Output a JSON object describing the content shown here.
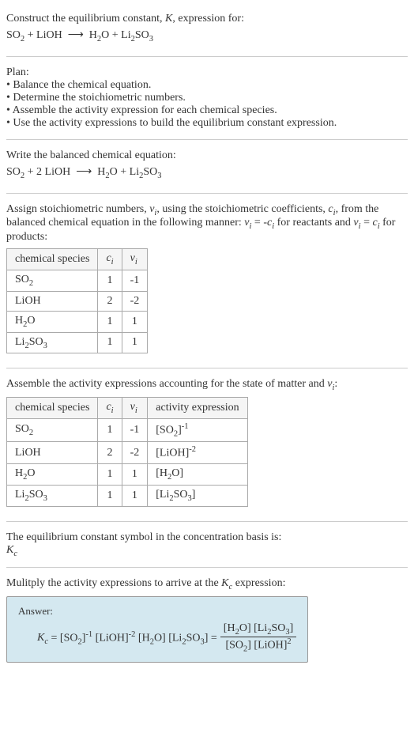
{
  "intro": {
    "line1": "Construct the equilibrium constant, K, expression for:",
    "equation": "SO₂ + LiOH ⟶ H₂O + Li₂SO₃"
  },
  "plan": {
    "heading": "Plan:",
    "items": [
      "Balance the chemical equation.",
      "Determine the stoichiometric numbers.",
      "Assemble the activity expression for each chemical species.",
      "Use the activity expressions to build the equilibrium constant expression."
    ]
  },
  "balanced": {
    "heading": "Write the balanced chemical equation:",
    "equation": "SO₂ + 2 LiOH ⟶ H₂O + Li₂SO₃"
  },
  "stoich": {
    "text1": "Assign stoichiometric numbers, νᵢ, using the stoichiometric coefficients, cᵢ, from the balanced chemical equation in the following manner: νᵢ = -cᵢ for reactants and νᵢ = cᵢ for products:",
    "headers": [
      "chemical species",
      "cᵢ",
      "νᵢ"
    ],
    "rows": [
      {
        "species": "SO₂",
        "c": "1",
        "v": "-1"
      },
      {
        "species": "LiOH",
        "c": "2",
        "v": "-2"
      },
      {
        "species": "H₂O",
        "c": "1",
        "v": "1"
      },
      {
        "species": "Li₂SO₃",
        "c": "1",
        "v": "1"
      }
    ]
  },
  "activity": {
    "heading": "Assemble the activity expressions accounting for the state of matter and νᵢ:",
    "headers": [
      "chemical species",
      "cᵢ",
      "νᵢ",
      "activity expression"
    ],
    "rows": [
      {
        "species": "SO₂",
        "c": "1",
        "v": "-1",
        "expr": "[SO₂]⁻¹"
      },
      {
        "species": "LiOH",
        "c": "2",
        "v": "-2",
        "expr": "[LiOH]⁻²"
      },
      {
        "species": "H₂O",
        "c": "1",
        "v": "1",
        "expr": "[H₂O]"
      },
      {
        "species": "Li₂SO₃",
        "c": "1",
        "v": "1",
        "expr": "[Li₂SO₃]"
      }
    ]
  },
  "symbol": {
    "line1": "The equilibrium constant symbol in the concentration basis is:",
    "line2": "K_c"
  },
  "multiply": {
    "heading": "Mulitply the activity expressions to arrive at the K_c expression:"
  },
  "answer": {
    "label": "Answer:",
    "lhs": "K_c = [SO₂]⁻¹ [LiOH]⁻² [H₂O] [Li₂SO₃] = ",
    "num": "[H₂O] [Li₂SO₃]",
    "den": "[SO₂] [LiOH]²"
  }
}
